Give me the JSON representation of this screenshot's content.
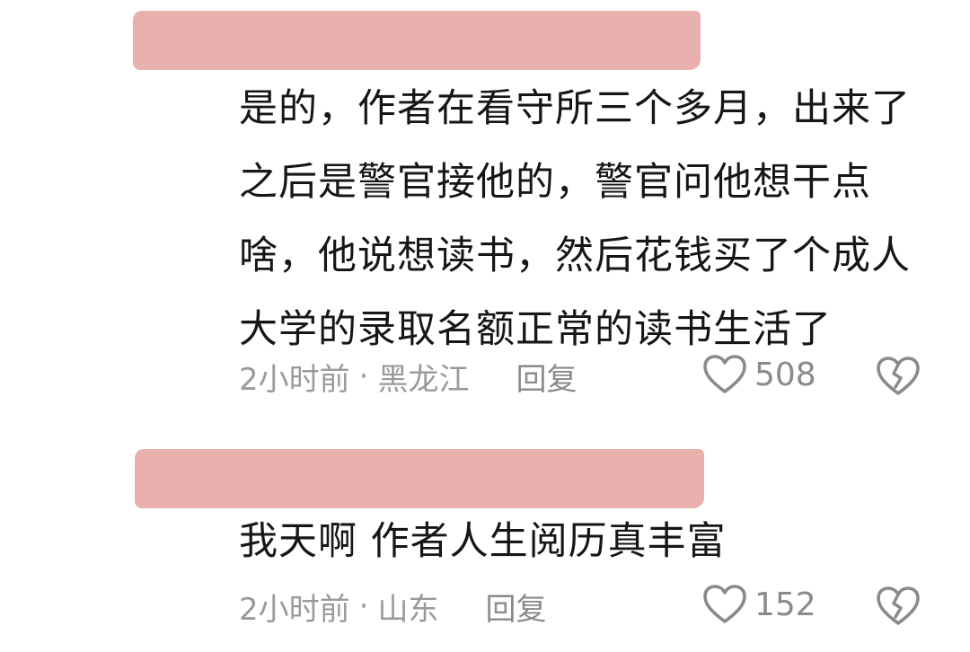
{
  "comments": [
    {
      "username_redacted": true,
      "text": "是的，作者在看守所三个多月，出来了\n之后是警官接他的，警官问他想干点\n啥，他说想读书，然后花钱买了个成人\n大学的录取名额正常的读书生活了",
      "time": "2小时前",
      "dot": "·",
      "location": "黑龙江",
      "reply_label": "回复",
      "likes": "508",
      "like_icon": "heart-outline-icon",
      "dislike_icon": "broken-heart-icon"
    },
    {
      "username_redacted": true,
      "text": "我天啊 作者人生阅历真丰富",
      "time": "2小时前",
      "dot": "·",
      "location": "山东",
      "reply_label": "回复",
      "likes": "152",
      "like_icon": "heart-outline-icon",
      "dislike_icon": "broken-heart-icon"
    }
  ],
  "colors": {
    "redaction": "#e8b1ae",
    "text": "#161616",
    "meta": "#9a9a9a"
  }
}
